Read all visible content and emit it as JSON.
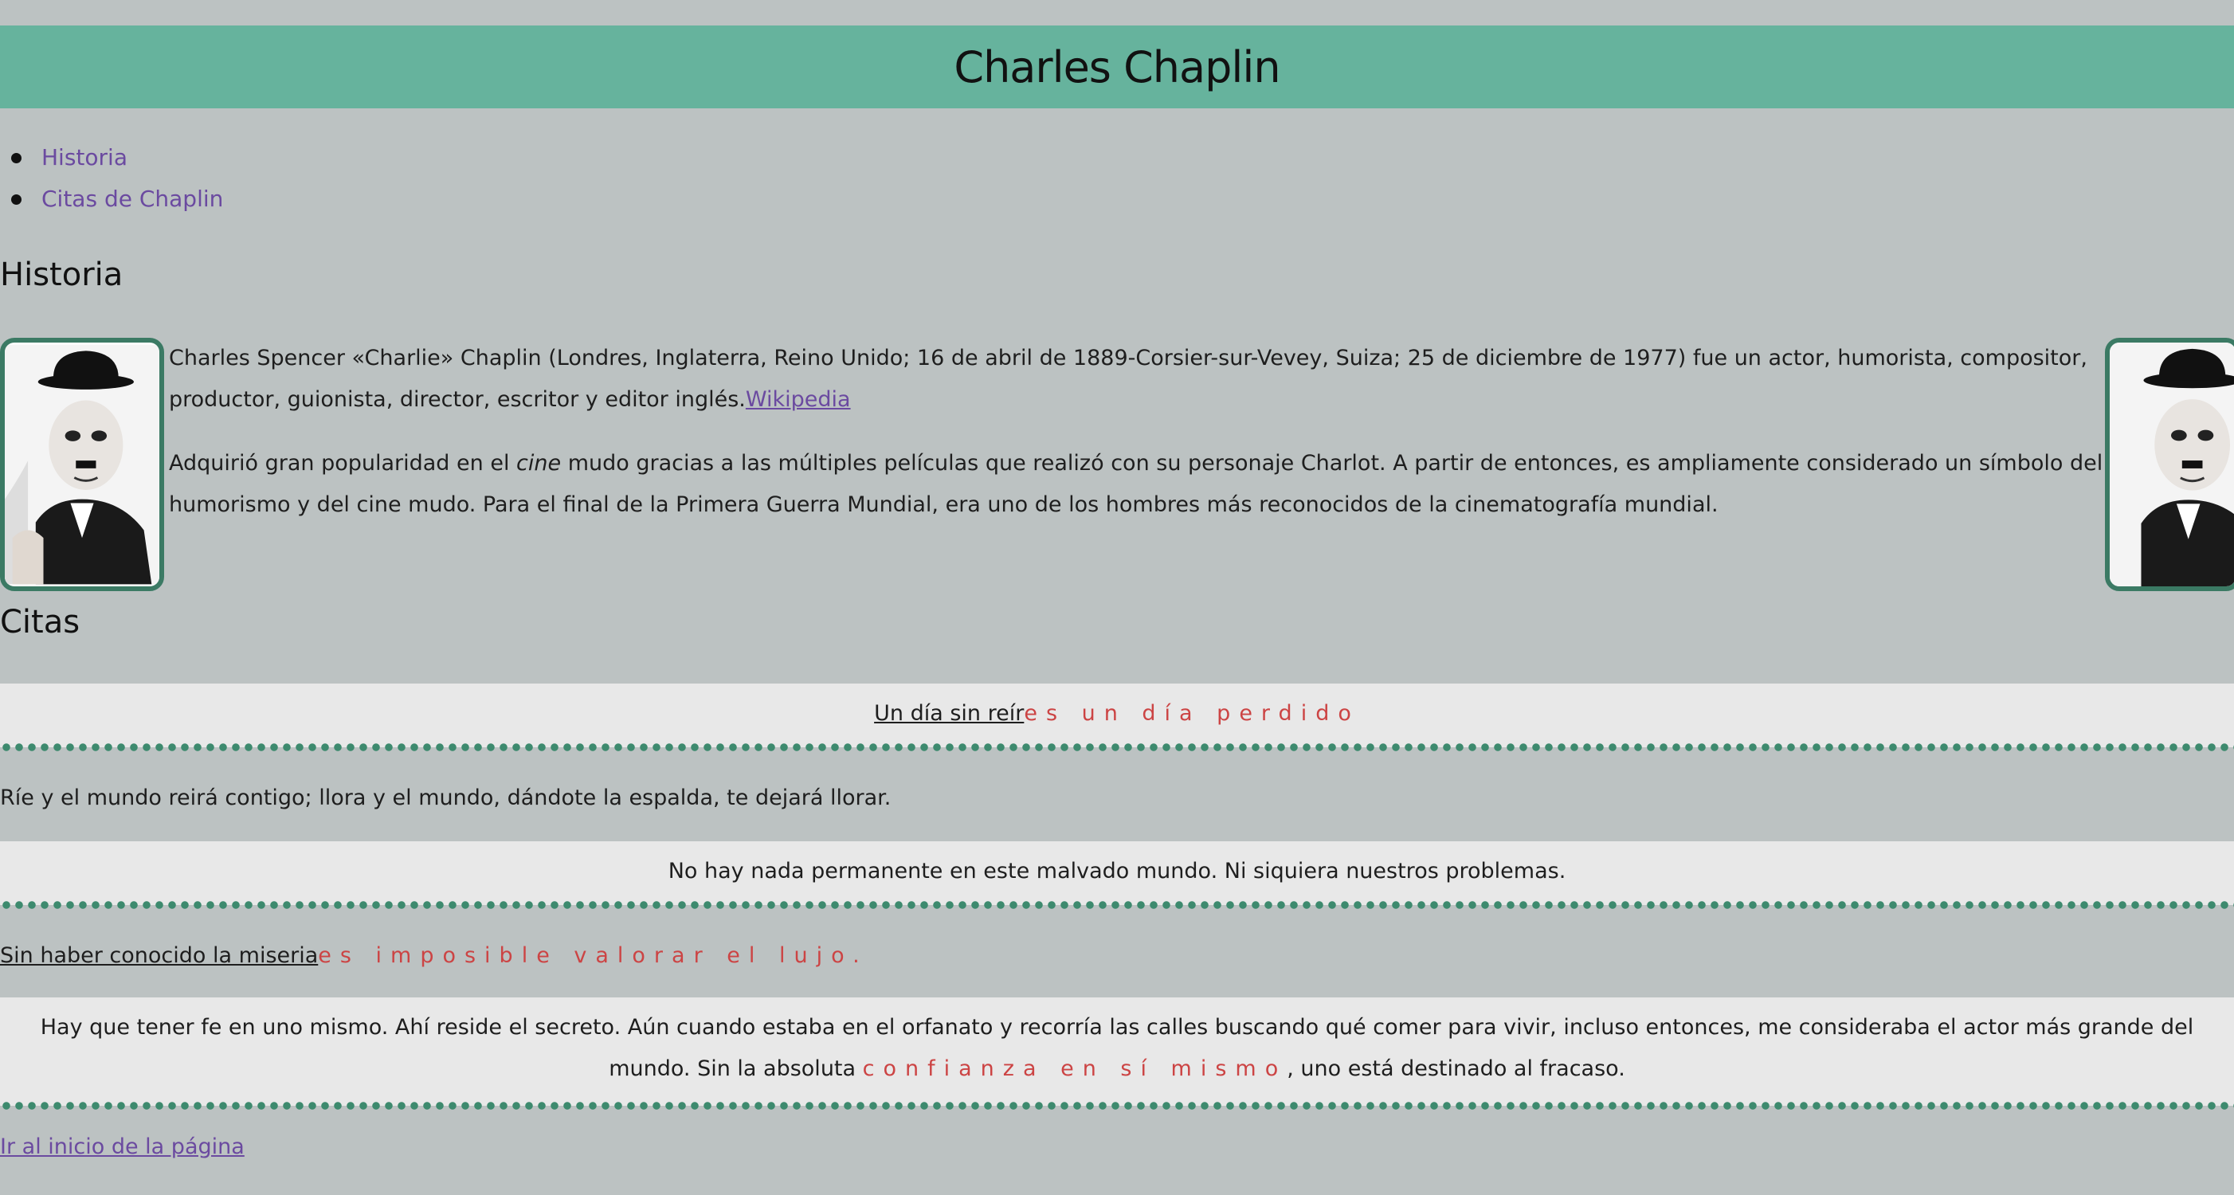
{
  "header": {
    "title": "Charles Chaplin"
  },
  "nav": {
    "items": [
      {
        "label": "Historia"
      },
      {
        "label": "Citas de Chaplin"
      }
    ]
  },
  "historia": {
    "heading": "Historia",
    "p1_text": "Charles Spencer «Charlie» Chaplin (Londres, Inglaterra, Reino Unido; 16 de abril de 1889-Corsier-sur-Vevey, Suiza; 25 de diciembre de 1977) fue un actor, humorista, compositor, productor, guionista, director, escritor y editor inglés.",
    "p1_link": "Wikipedia",
    "p2_before": "Adquirió gran popularidad en el ",
    "p2_em": "cine",
    "p2_after": " mudo gracias a las múltiples películas que realizó con su personaje Charlot. A partir de entonces, es ampliamente considerado un símbolo del humorismo y del cine mudo. Para el final de la Primera Guerra Mundial, era uno de los hombres más reconocidos de la cinematografía mundial."
  },
  "citas": {
    "heading": "Citas",
    "q1_a": "Un día sin reír",
    "q1_b": "es un día perdido",
    "q2": "Ríe y el mundo reirá contigo; llora y el mundo, dándote la espalda, te dejará llorar.",
    "q3": "No hay nada permanente en este malvado mundo. Ni siquiera nuestros problemas.",
    "q4_a": "Sin haber conocido la miseria",
    "q4_b": "es imposible valorar el lujo.",
    "q5_a": "Hay que tener fe en uno mismo. Ahí reside el secreto. Aún cuando estaba en el orfanato y recorría las calles buscando qué comer para vivir, incluso entonces, me consideraba el actor más grande del mundo. Sin la absoluta ",
    "q5_b": "confianza en sí mismo",
    "q5_c": ", uno está destinado al fracaso."
  },
  "footer": {
    "top_link": "Ir al inicio de la página"
  },
  "colors": {
    "background": "#bcc2c2",
    "header": "#66b39d",
    "link": "#6b4aa0",
    "accent_red": "#cc4444",
    "dots": "#3d8a6e"
  }
}
